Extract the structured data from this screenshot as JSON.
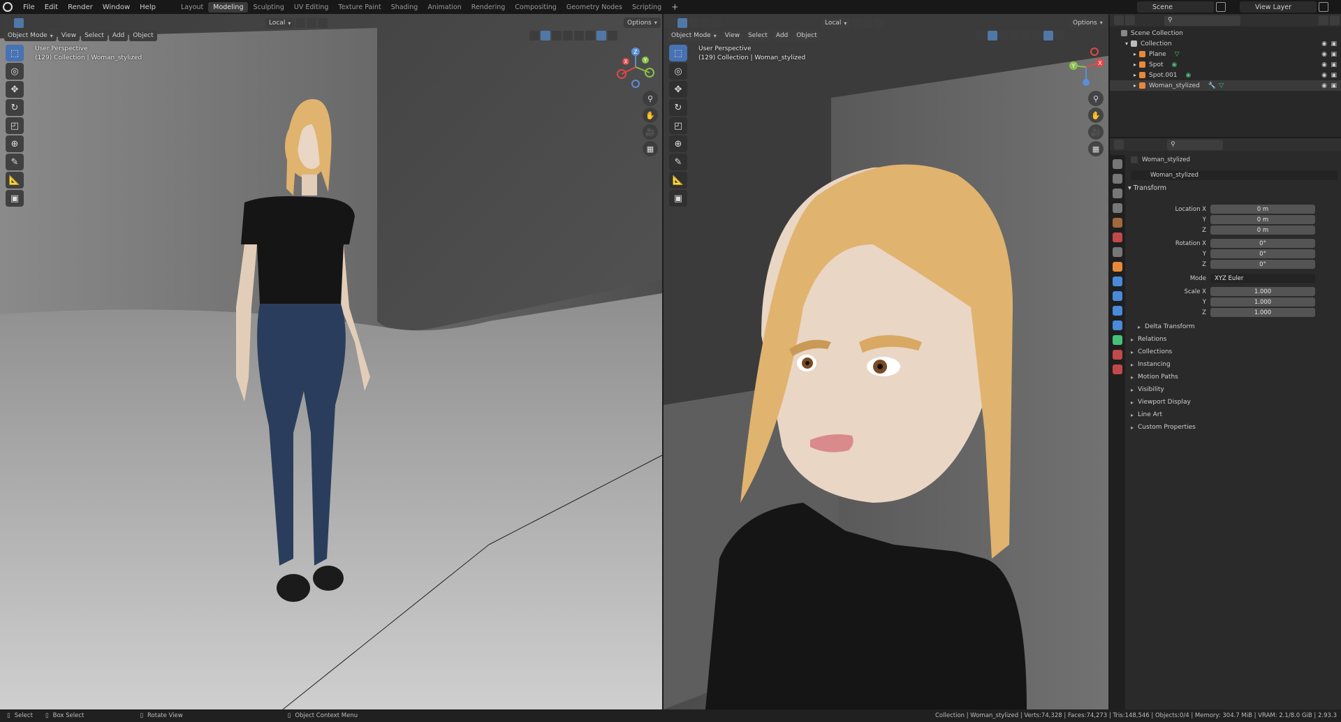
{
  "topbar": {
    "menu": [
      "File",
      "Edit",
      "Render",
      "Window",
      "Help"
    ],
    "workspaces": [
      "Layout",
      "Modeling",
      "Sculpting",
      "UV Editing",
      "Texture Paint",
      "Shading",
      "Animation",
      "Rendering",
      "Compositing",
      "Geometry Nodes",
      "Scripting"
    ],
    "active_workspace": "Modeling",
    "add_workspace": "+",
    "scene": "Scene",
    "view_layer": "View Layer"
  },
  "viewport_header": {
    "transform_orientation": "Local",
    "options": "Options",
    "mode": "Object Mode",
    "menus": [
      "View",
      "Select",
      "Add",
      "Object"
    ]
  },
  "left_viewport": {
    "view_name": "User Perspective",
    "collection_info": "(129) Collection | Woman_stylized"
  },
  "right_viewport": {
    "view_name": "User Perspective",
    "collection_info": "(129) Collection | Woman_stylized"
  },
  "gizmo": {
    "x": "X",
    "y": "Y",
    "z": "Z"
  },
  "outliner": {
    "root": "Scene Collection",
    "collection": "Collection",
    "items": [
      "Plane",
      "Spot",
      "Spot.001",
      "Woman_stylized"
    ]
  },
  "properties": {
    "object_name": "Woman_stylized",
    "datablock": "Woman_stylized",
    "transform_label": "Transform",
    "location_x_label": "Location X",
    "rotation_x_label": "Rotation X",
    "scale_x_label": "Scale X",
    "y_label": "Y",
    "z_label": "Z",
    "mode_label": "Mode",
    "location": [
      "0 m",
      "0 m",
      "0 m"
    ],
    "rotation": [
      "0°",
      "0°",
      "0°"
    ],
    "mode": "XYZ Euler",
    "scale": [
      "1.000",
      "1.000",
      "1.000"
    ],
    "delta_transform": "Delta Transform",
    "panels": [
      "Relations",
      "Collections",
      "Instancing",
      "Motion Paths",
      "Visibility",
      "Viewport Display",
      "Line Art",
      "Custom Properties"
    ]
  },
  "statusbar": {
    "select": "Select",
    "box_select": "Box Select",
    "rotate_view": "Rotate View",
    "context_menu": "Object Context Menu",
    "stats": "Collection | Woman_stylized | Verts:74,328 | Faces:74,273 | Tris:148,546 | Objects:0/4 | Memory: 304.7 MiB | VRAM: 2.1/8.0 GiB | 2.93.3"
  },
  "colors": {
    "accent": "#4772b3",
    "hair": "#e0b36f",
    "skin": "#e9d6c4",
    "shirt": "#141414",
    "jeans": "#2a3d5c",
    "object_orange": "#e8893a",
    "mesh_green": "#47c07a"
  }
}
